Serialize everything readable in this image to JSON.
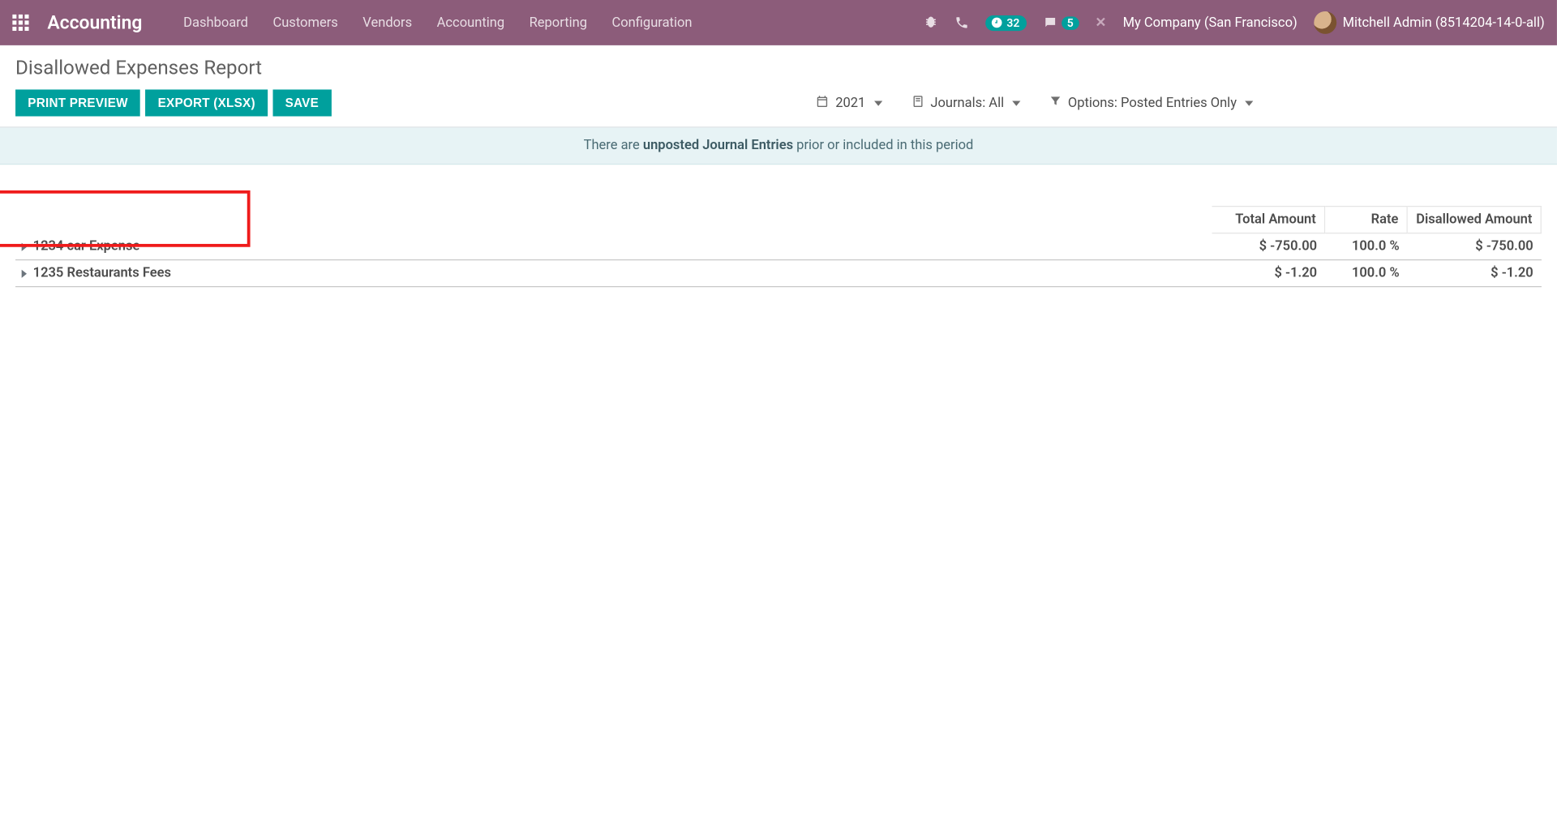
{
  "nav": {
    "brand": "Accounting",
    "items": [
      "Dashboard",
      "Customers",
      "Vendors",
      "Accounting",
      "Reporting",
      "Configuration"
    ],
    "activities_count": "32",
    "messages_count": "5",
    "company": "My Company (San Francisco)",
    "user": "Mitchell Admin (8514204-14-0-all)"
  },
  "control_panel": {
    "title": "Disallowed Expenses Report",
    "buttons": {
      "print": "PRINT PREVIEW",
      "export": "EXPORT (XLSX)",
      "save": "SAVE"
    },
    "filters": {
      "date": "2021",
      "journals_label": "Journals:",
      "journals_value": "All",
      "options_label": "Options:",
      "options_value": "Posted Entries Only"
    }
  },
  "alert": {
    "pre": "There are ",
    "bold": "unposted Journal Entries",
    "post": " prior or included in this period"
  },
  "report": {
    "headers": {
      "total": "Total Amount",
      "rate": "Rate",
      "disallowed": "Disallowed Amount"
    },
    "rows": [
      {
        "name": "1234 car Expense",
        "total": "$ -750.00",
        "rate": "100.0 %",
        "disallowed": "$ -750.00"
      },
      {
        "name": "1235 Restaurants Fees",
        "total": "$ -1.20",
        "rate": "100.0 %",
        "disallowed": "$ -1.20"
      }
    ]
  }
}
